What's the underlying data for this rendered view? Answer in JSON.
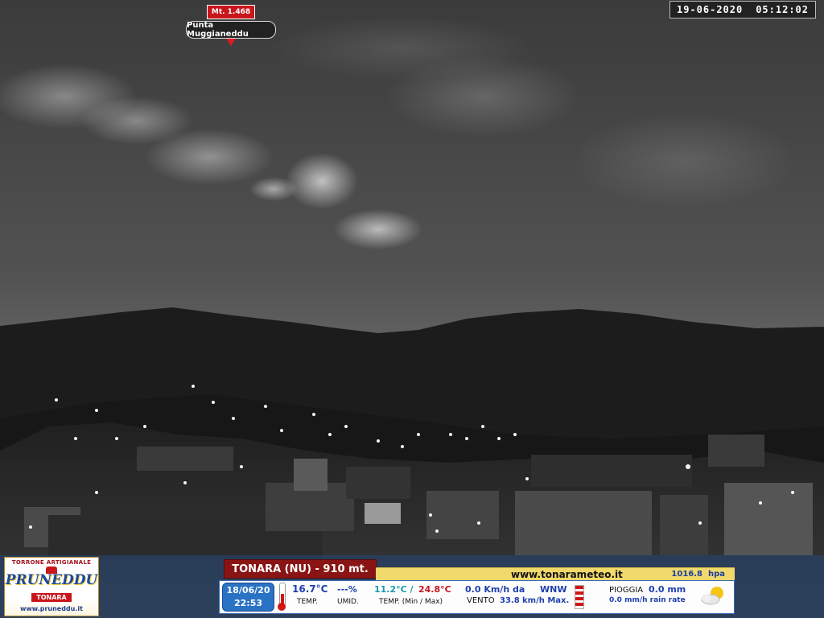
{
  "overlay": {
    "timestamp": {
      "date": "19-06-2020",
      "time": "05:12:02"
    },
    "peak": {
      "altitude": "Mt. 1.468",
      "name": "Punta Muggianeddu"
    }
  },
  "sponsor": {
    "tagline": "TORRONE ARTIGIANALE",
    "brand": "PRUNEDDU",
    "place": "TONARA",
    "url": "www.pruneddu.it"
  },
  "weather": {
    "station_title": "TONARA (NU) - 910 mt.",
    "site_url": "www.tonarameteo.it",
    "pressure": {
      "value": "1016.8",
      "unit": "hpa"
    },
    "date": "18/06/20",
    "time": "22:53",
    "temperature": {
      "value": "16.7°C",
      "label": "TEMP."
    },
    "humidity": {
      "value": "---%",
      "label": "UMID."
    },
    "temp_minmax": {
      "min": "11.2°C /",
      "max": "24.8°C",
      "label": "TEMP. (Min / Max)"
    },
    "wind": {
      "speed": "0.0 Km/h da",
      "direction": "WNW",
      "label": "VENTO",
      "max_value": "33.8",
      "max_label": "km/h Max."
    },
    "rain": {
      "label": "PIOGGIA",
      "value": "0.0 mm",
      "rate": "0.0 mm/h rain rate"
    },
    "thermometer_fill": 0.55,
    "icon": "partly-cloudy-icon"
  },
  "colors": {
    "title_red": "#8a1414",
    "accent_blue": "#1f3fae",
    "panel_yellow": "#f1d96b"
  }
}
